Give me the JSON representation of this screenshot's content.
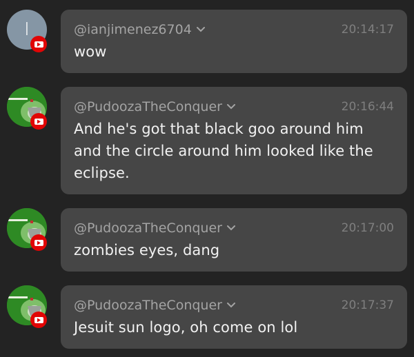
{
  "messages": [
    {
      "avatar_initial": "I",
      "username": "@ianjimenez6704",
      "timestamp": "20:14:17",
      "text": "wow",
      "platform_icon": "youtube-icon",
      "avatar_color": "#8596a5"
    },
    {
      "username": "@PudoozaTheConquer",
      "timestamp": "20:16:44",
      "text": "And he's got that black goo around him and the circle around him looked like the eclipse.",
      "platform_icon": "youtube-icon",
      "avatar_color": "#2e8a24"
    },
    {
      "username": "@PudoozaTheConquer",
      "timestamp": "20:17:00",
      "text": "zombies eyes, dang",
      "platform_icon": "youtube-icon",
      "avatar_color": "#2e8a24"
    },
    {
      "username": "@PudoozaTheConquer",
      "timestamp": "20:17:37",
      "text": "Jesuit sun logo, oh come on lol",
      "platform_icon": "youtube-icon",
      "avatar_color": "#2e8a24"
    }
  ],
  "colors": {
    "background": "#232323",
    "bubble": "#464646",
    "username": "#a4a4a4",
    "timestamp": "#7f7f7f",
    "text": "#f2f2f2",
    "youtube_red": "#e10505"
  }
}
